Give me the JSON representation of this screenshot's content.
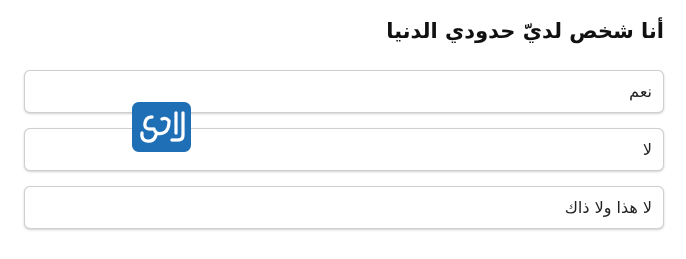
{
  "question": {
    "title": "أنا شخص لديّ حدودي الدنيا"
  },
  "options": [
    {
      "label": "نعم"
    },
    {
      "label": "لا"
    },
    {
      "label": "لا هذا ولا ذاك"
    }
  ],
  "watermark": {
    "icon": "watermark-logo-icon",
    "text": "المرجع"
  },
  "colors": {
    "logo_background": "#1f6fb6",
    "border": "#cfcfcf",
    "text": "#111111"
  }
}
